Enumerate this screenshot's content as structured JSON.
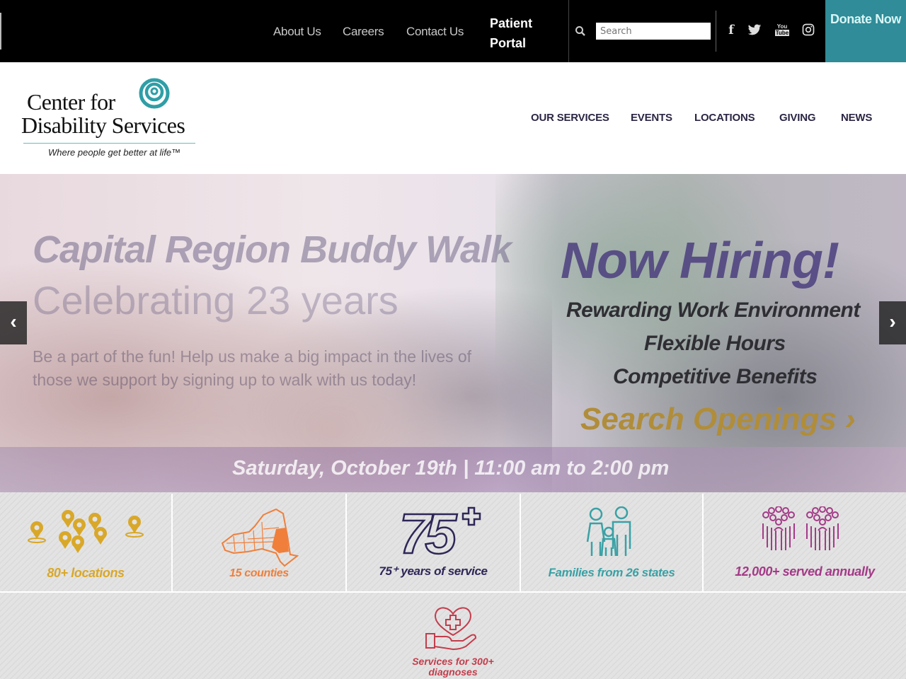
{
  "topbar": {
    "links": [
      "About Us",
      "Careers",
      "Contact Us"
    ],
    "patient_portal": "Patient Portal",
    "search_placeholder": "Search",
    "search_value": "",
    "social": [
      {
        "name": "facebook",
        "glyph": "f"
      },
      {
        "name": "twitter",
        "glyph": "t"
      },
      {
        "name": "youtube",
        "glyph": "You Tube"
      },
      {
        "name": "instagram",
        "glyph": "ig"
      }
    ],
    "donate_label": "Donate Now"
  },
  "header": {
    "logo_line1": "Center for",
    "logo_line2": "Disability Services",
    "logo_tagline": "Where people get better at life™",
    "nav": [
      "OUR SERVICES",
      "EVENTS",
      "LOCATIONS",
      "GIVING",
      "NEWS"
    ],
    "colors": {
      "accent": "#2f9ea6",
      "nav_text": "#2c2544"
    }
  },
  "hero": {
    "prev_icon": "‹",
    "next_icon": "›",
    "slide1": {
      "title": "Capital Region Buddy Walk",
      "subtitle": "Celebrating 23 years",
      "body": "Be a part of the fun! Help us make a big impact in the lives of those we support by signing up to walk with us today!",
      "date": "Saturday, October 19th | 11:00 am to 2:00 pm"
    },
    "slide2": {
      "title": "Now Hiring!",
      "lines": [
        "Rewarding Work Environment",
        "Flexible Hours",
        "Competitive Benefits"
      ],
      "cta": "Search Openings ›"
    }
  },
  "stats": [
    {
      "label": "80+ locations",
      "icon": "map-pins-icon",
      "color": "#d9a829"
    },
    {
      "label": "15 counties",
      "icon": "new-york-map-icon",
      "color": "#ef7f3b"
    },
    {
      "label": "75⁺ years of service",
      "icon": "75-plus-icon",
      "color": "#2e2657"
    },
    {
      "label": "Families from 26 states",
      "icon": "family-icon",
      "color": "#3aa1a5"
    },
    {
      "label": "12,000+ served annually",
      "icon": "crowd-icon",
      "color": "#a33a87"
    },
    {
      "label": "Services for 300+ diagnoses",
      "icon": "heart-hand-icon",
      "color": "#c33d4c"
    }
  ]
}
